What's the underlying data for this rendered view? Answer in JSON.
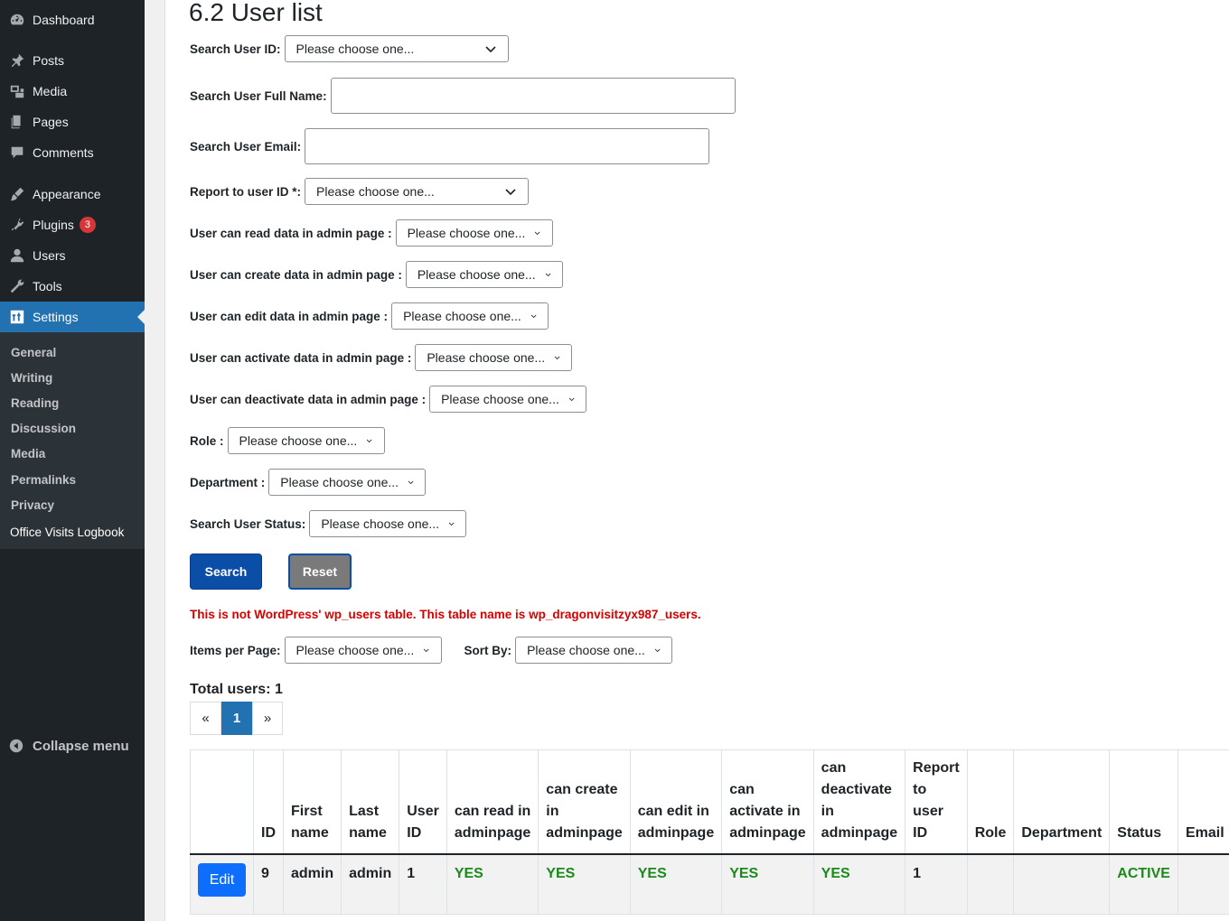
{
  "sidebar": {
    "items": [
      {
        "label": "Dashboard",
        "icon": "dashboard-icon"
      },
      {
        "label": "Posts",
        "icon": "pin-icon"
      },
      {
        "label": "Media",
        "icon": "media-icon"
      },
      {
        "label": "Pages",
        "icon": "pages-icon"
      },
      {
        "label": "Comments",
        "icon": "comments-icon"
      },
      {
        "label": "Appearance",
        "icon": "brush-icon"
      },
      {
        "label": "Plugins",
        "icon": "plugin-icon",
        "badge": "3"
      },
      {
        "label": "Users",
        "icon": "user-icon"
      },
      {
        "label": "Tools",
        "icon": "wrench-icon"
      },
      {
        "label": "Settings",
        "icon": "settings-icon",
        "active": true
      }
    ],
    "submenu": [
      "General",
      "Writing",
      "Reading",
      "Discussion",
      "Media",
      "Permalinks",
      "Privacy",
      "Office Visits Logbook"
    ],
    "collapse_label": "Collapse menu"
  },
  "page": {
    "title": "6.2 User list"
  },
  "form": {
    "placeholder_choice": "Please choose one...",
    "search_user_id_label": "Search User ID:",
    "full_name_label": "Search User Full Name:",
    "email_label": "Search User Email:",
    "report_to_label": "Report to user ID *:",
    "can_read_label": "User can read data in admin page :",
    "can_create_label": "User can create data in admin page :",
    "can_edit_label": "User can edit data in admin page :",
    "can_activate_label": "User can activate data in admin page :",
    "can_deactivate_label": "User can deactivate data in admin page :",
    "role_label": "Role :",
    "department_label": "Department :",
    "status_label": "Search User Status:",
    "search_button": "Search",
    "reset_button": "Reset"
  },
  "warning": "This is not WordPress' wp_users table. This table name is wp_dragonvisitzyx987_users.",
  "listing": {
    "items_per_page_label": "Items per Page:",
    "sort_by_label": "Sort By:",
    "total_users": "Total users: 1",
    "pager": {
      "prev": "«",
      "current": "1",
      "next": "»"
    }
  },
  "table": {
    "headers": [
      "",
      "ID",
      "First name",
      "Last name",
      "User ID",
      "can read in adminpage",
      "can create in adminpage",
      "can edit in adminpage",
      "can activate in adminpage",
      "can deactivate in adminpage",
      "Report to user ID",
      "Role",
      "Department",
      "Status",
      "Email"
    ],
    "rows": [
      {
        "edit": "Edit",
        "id": "9",
        "first_name": "admin",
        "last_name": "admin",
        "user_id": "1",
        "can_read": "YES",
        "can_create": "YES",
        "can_edit": "YES",
        "can_activate": "YES",
        "can_deactivate": "YES",
        "report_to": "1",
        "role": "",
        "department": "",
        "status": "ACTIVE",
        "email": ""
      }
    ]
  },
  "colors": {
    "sidebar_bg": "#1d2327",
    "active_bg": "#2271b1",
    "search_button": "#0a4ea8",
    "warning": "#d60000",
    "yes": "#1a8a1a"
  }
}
